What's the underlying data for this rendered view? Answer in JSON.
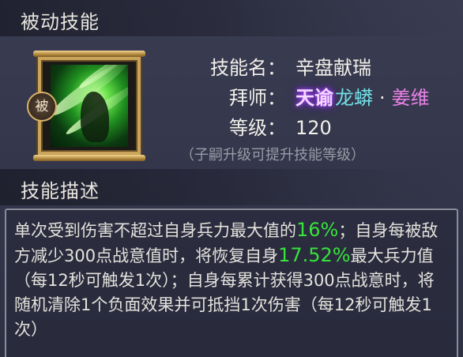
{
  "header": {
    "passive_title": "被动技能",
    "description_title": "技能描述"
  },
  "skill": {
    "icon_name": "green-spirit-skill-icon",
    "badge": "被",
    "name_label": "技能名",
    "name_value": "辛盘献瑞",
    "master_label": "拜师",
    "master_title": "天谕",
    "master_name_1": "龙蟒",
    "master_separator": "·",
    "master_name_2": "姜维",
    "level_label": "等级",
    "level_value": "120",
    "colon": "：",
    "hint": "（子嗣升级可提升技能等级）"
  },
  "description": {
    "part1": "单次受到伤害不超过自身兵力最大值的",
    "value1": "16%",
    "part2": "；自身每被敌方减少300点战意值时，将恢复自身",
    "value2": "17.52%",
    "part3": "最大兵力值（每12秒可触发1次）；自身每累计获得300点战意时，将随机清除1个负面效果并可抵挡1次伤害（每12秒可触发1次）"
  },
  "colors": {
    "highlight": "#37e23b",
    "master_name_1": "#6fe0e6",
    "master_name_2": "#e982e6",
    "frame_gold": "#c9a45a"
  }
}
